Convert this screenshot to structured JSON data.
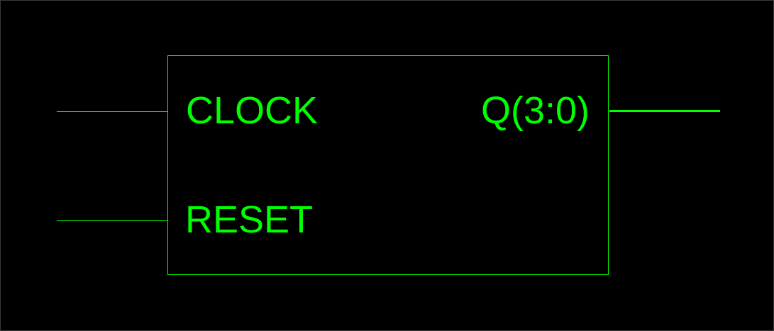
{
  "colors": {
    "background": "#000000",
    "symbol": "#00ff00"
  },
  "symbol": {
    "inputs": [
      {
        "label": "CLOCK"
      },
      {
        "label": "RESET"
      }
    ],
    "outputs": [
      {
        "label": "Q(3:0)",
        "bus": true
      }
    ]
  }
}
